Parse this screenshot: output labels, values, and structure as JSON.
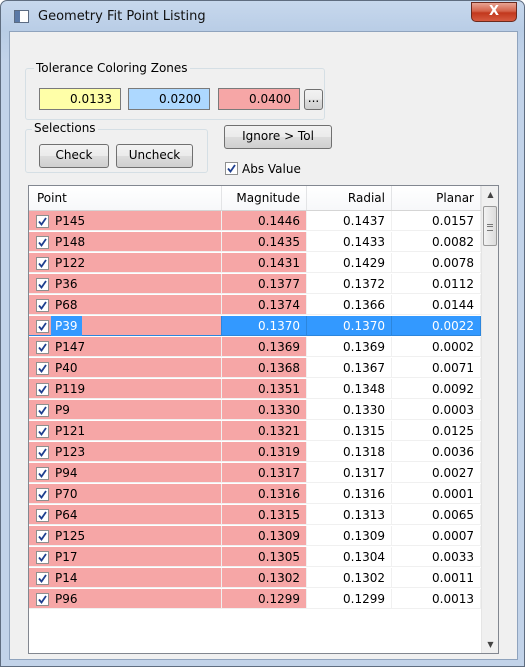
{
  "window": {
    "title": "Geometry Fit Point Listing",
    "close_glyph": "X"
  },
  "tolerance": {
    "group_label": "Tolerance Coloring Zones",
    "zones": [
      {
        "value": "0.0133",
        "color": "#ffffa8"
      },
      {
        "value": "0.0200",
        "color": "#add8ff"
      },
      {
        "value": "0.0400",
        "color": "#f6a6a6"
      }
    ],
    "more_button": "..."
  },
  "selections": {
    "group_label": "Selections",
    "check_button": "Check",
    "uncheck_button": "Uncheck"
  },
  "ignore_button": "Ignore > Tol",
  "abs_value": {
    "label": "Abs Value",
    "checked": true
  },
  "table": {
    "columns": [
      "Point",
      "Magnitude",
      "Radial",
      "Planar"
    ],
    "selected_row": 5,
    "rows": [
      {
        "point": "P145",
        "magnitude": "0.1446",
        "radial": "0.1437",
        "planar": "0.0157"
      },
      {
        "point": "P148",
        "magnitude": "0.1435",
        "radial": "0.1433",
        "planar": "0.0082"
      },
      {
        "point": "P122",
        "magnitude": "0.1431",
        "radial": "0.1429",
        "planar": "0.0078"
      },
      {
        "point": "P36",
        "magnitude": "0.1377",
        "radial": "0.1372",
        "planar": "0.0112"
      },
      {
        "point": "P68",
        "magnitude": "0.1374",
        "radial": "0.1366",
        "planar": "0.0144"
      },
      {
        "point": "P39",
        "magnitude": "0.1370",
        "radial": "0.1370",
        "planar": "0.0022"
      },
      {
        "point": "P147",
        "magnitude": "0.1369",
        "radial": "0.1369",
        "planar": "0.0002"
      },
      {
        "point": "P40",
        "magnitude": "0.1368",
        "radial": "0.1367",
        "planar": "0.0071"
      },
      {
        "point": "P119",
        "magnitude": "0.1351",
        "radial": "0.1348",
        "planar": "0.0092"
      },
      {
        "point": "P9",
        "magnitude": "0.1330",
        "radial": "0.1330",
        "planar": "0.0003"
      },
      {
        "point": "P121",
        "magnitude": "0.1321",
        "radial": "0.1315",
        "planar": "0.0125"
      },
      {
        "point": "P123",
        "magnitude": "0.1319",
        "radial": "0.1318",
        "planar": "0.0036"
      },
      {
        "point": "P94",
        "magnitude": "0.1317",
        "radial": "0.1317",
        "planar": "0.0027"
      },
      {
        "point": "P70",
        "magnitude": "0.1316",
        "radial": "0.1316",
        "planar": "0.0001"
      },
      {
        "point": "P64",
        "magnitude": "0.1315",
        "radial": "0.1313",
        "planar": "0.0065"
      },
      {
        "point": "P125",
        "magnitude": "0.1309",
        "radial": "0.1309",
        "planar": "0.0007"
      },
      {
        "point": "P17",
        "magnitude": "0.1305",
        "radial": "0.1304",
        "planar": "0.0033"
      },
      {
        "point": "P14",
        "magnitude": "0.1302",
        "radial": "0.1302",
        "planar": "0.0011"
      },
      {
        "point": "P96",
        "magnitude": "0.1299",
        "radial": "0.1299",
        "planar": "0.0013"
      }
    ]
  },
  "scrollbar": {
    "up_glyph": "▲",
    "down_glyph": "▼"
  },
  "icons": {
    "app": "window-app-icon",
    "close": "close-icon",
    "check": "checkmark-icon"
  }
}
